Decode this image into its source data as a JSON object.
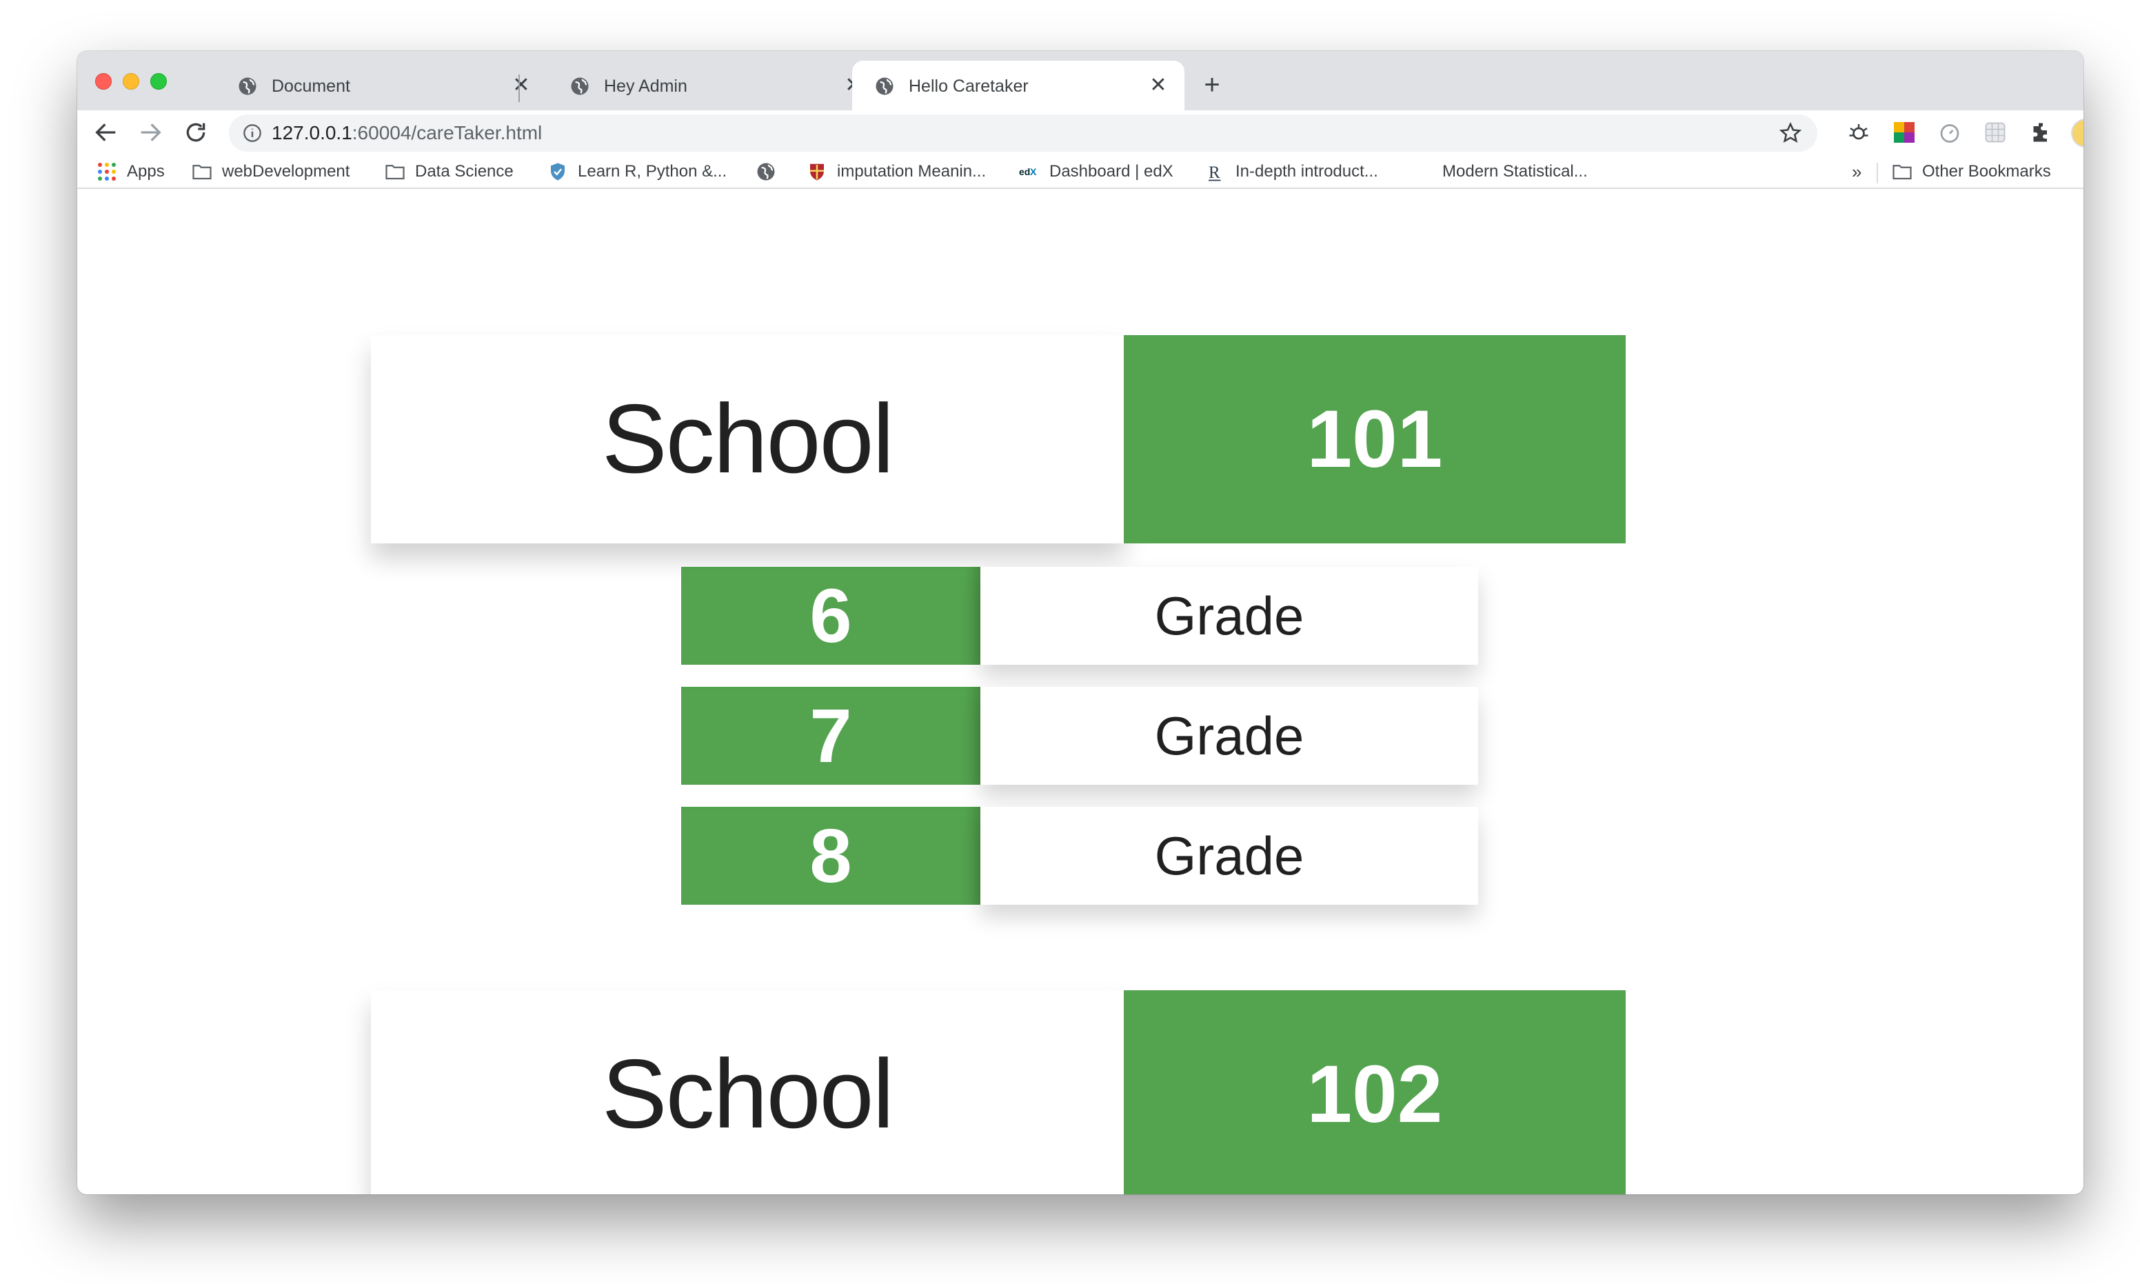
{
  "browser": {
    "tabs": [
      {
        "title": "Document",
        "close": "✕"
      },
      {
        "title": "Hey Admin",
        "close": "✕"
      },
      {
        "title": "Hello Caretaker",
        "close": "✕"
      }
    ],
    "new_tab": "+",
    "url_host": "127.0.0.1",
    "url_rest": ":60004/careTaker.html",
    "bookmarks": [
      {
        "label": "Apps",
        "icon": "apps-grid-icon"
      },
      {
        "label": "webDevelopment",
        "icon": "folder-icon"
      },
      {
        "label": "Data Science",
        "icon": "folder-icon"
      },
      {
        "label": "Learn R, Python &...",
        "icon": "shield-icon"
      },
      {
        "label": "",
        "icon": "globe-icon"
      },
      {
        "label": "imputation Meanin...",
        "icon": "crest-icon"
      },
      {
        "label": "Dashboard | edX",
        "icon": "edx-icon"
      },
      {
        "label": "In-depth introduct...",
        "icon": "r-icon"
      },
      {
        "label": "Modern Statistical...",
        "icon": ""
      }
    ],
    "more_bookmarks": "»",
    "other_bookmarks": "Other Bookmarks"
  },
  "page": {
    "schools": [
      {
        "label": "School",
        "number": "101"
      },
      {
        "label": "School",
        "number": "102"
      }
    ],
    "grades": [
      {
        "number": "6",
        "label": "Grade"
      },
      {
        "number": "7",
        "label": "Grade"
      },
      {
        "number": "8",
        "label": "Grade"
      }
    ]
  },
  "colors": {
    "accent_green": "#53a34f",
    "tabstrip": "#dfe1e5",
    "text_dark": "#212121"
  }
}
